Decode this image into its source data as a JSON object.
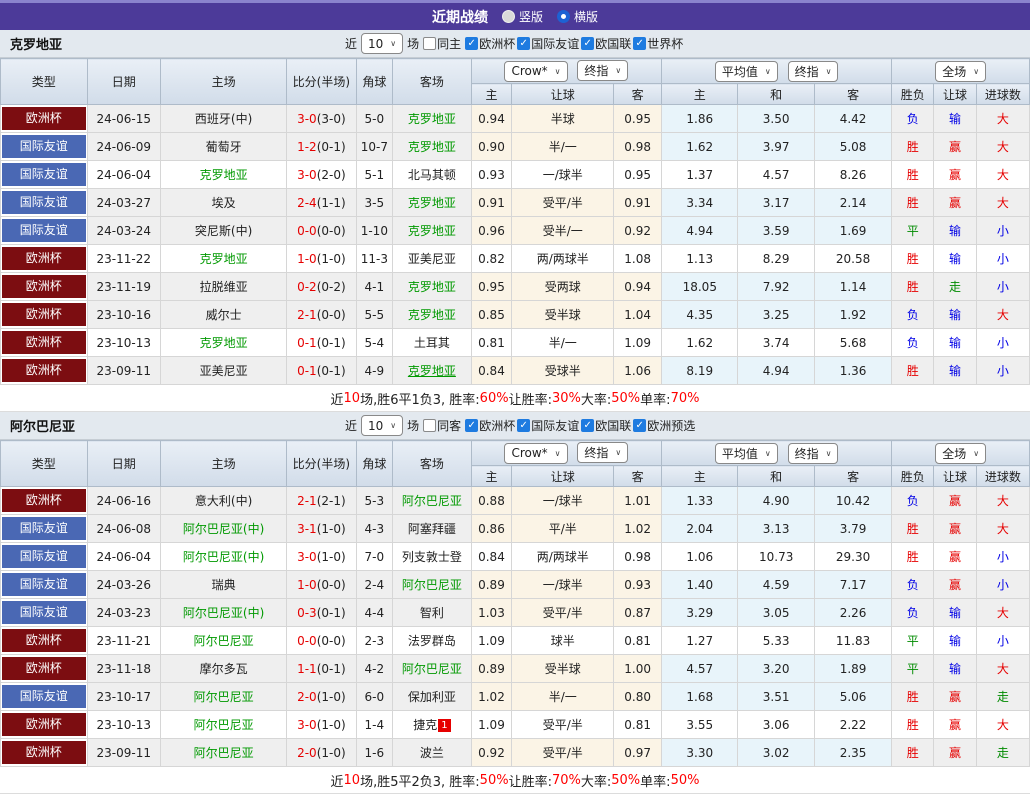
{
  "titlebar": {
    "title": "近期战绩",
    "layout_radios": {
      "vertical": {
        "label": "竖版",
        "selected": true
      },
      "horizontal": {
        "label": "横版",
        "selected": false
      }
    }
  },
  "table_header": {
    "type": "类型",
    "date": "日期",
    "home": "主场",
    "score": "比分(半场)",
    "corner": "角球",
    "away": "客场",
    "book_select": "Crow*",
    "final_select1": "终指",
    "avg_select": "平均值",
    "final_select2": "终指",
    "scope_select": "全场",
    "sub": [
      "主",
      "让球",
      "客",
      "主",
      "和",
      "客",
      "胜负",
      "让球",
      "进球数"
    ]
  },
  "icons": {
    "check": "✓",
    "chevron_down": "∨"
  },
  "colors": {
    "titlebar_bg": "#4c3a99",
    "league_colors": {
      "欧洲杯": "#7c0d11",
      "国际友谊": "#4a68b4"
    },
    "subject_team": "#009900",
    "score_red": "#e60000",
    "crow_col_bg": "#fbf4e6",
    "avg_col_bg": "#e8f4fa",
    "result_text_colors": {
      "胜": "#e60000",
      "赢": "#e60000",
      "大": "#e60000",
      "负": "#0000e6",
      "输": "#0000e6",
      "小": "#0000e6",
      "平": "#008b00",
      "走": "#008b00"
    }
  },
  "sections": [
    {
      "team": "克罗地亚",
      "filter": {
        "near_label": "近",
        "count": "10",
        "unit_label": "场",
        "same_label": "同主",
        "same_checked": false,
        "leagues": [
          {
            "label": "欧洲杯",
            "checked": true
          },
          {
            "label": "国际友谊",
            "checked": true
          },
          {
            "label": "欧国联",
            "checked": true
          },
          {
            "label": "世界杯",
            "checked": true
          }
        ]
      },
      "rows": [
        {
          "league": "欧洲杯",
          "date": "24-06-15",
          "home": "西班牙(中)",
          "home_subject": false,
          "score": "3-0",
          "half": "(3-0)",
          "corner": "5-0",
          "away": "克罗地亚",
          "away_subject": true,
          "odds_home": "0.94",
          "handicap": "半球",
          "odds_away": "0.95",
          "avg_home": "1.86",
          "avg_draw": "3.50",
          "avg_away": "4.42",
          "res_match": "负",
          "res_handicap": "输",
          "res_goals": "大"
        },
        {
          "league": "国际友谊",
          "date": "24-06-09",
          "home": "葡萄牙",
          "home_subject": false,
          "score": "1-2",
          "half": "(0-1)",
          "corner": "10-7",
          "away": "克罗地亚",
          "away_subject": true,
          "odds_home": "0.90",
          "handicap": "半/一",
          "odds_away": "0.98",
          "avg_home": "1.62",
          "avg_draw": "3.97",
          "avg_away": "5.08",
          "res_match": "胜",
          "res_handicap": "赢",
          "res_goals": "大"
        },
        {
          "league": "国际友谊",
          "date": "24-06-04",
          "home": "克罗地亚",
          "home_subject": true,
          "score": "3-0",
          "half": "(2-0)",
          "corner": "5-1",
          "away": "北马其顿",
          "away_subject": false,
          "odds_home": "0.93",
          "handicap": "一/球半",
          "odds_away": "0.95",
          "avg_home": "1.37",
          "avg_draw": "4.57",
          "avg_away": "8.26",
          "res_match": "胜",
          "res_handicap": "赢",
          "res_goals": "大"
        },
        {
          "league": "国际友谊",
          "date": "24-03-27",
          "home": "埃及",
          "home_subject": false,
          "score": "2-4",
          "half": "(1-1)",
          "corner": "3-5",
          "away": "克罗地亚",
          "away_subject": true,
          "odds_home": "0.91",
          "handicap": "受平/半",
          "odds_away": "0.91",
          "avg_home": "3.34",
          "avg_draw": "3.17",
          "avg_away": "2.14",
          "res_match": "胜",
          "res_handicap": "赢",
          "res_goals": "大"
        },
        {
          "league": "国际友谊",
          "date": "24-03-24",
          "home": "突尼斯(中)",
          "home_subject": false,
          "score": "0-0",
          "half": "(0-0)",
          "corner": "1-10",
          "away": "克罗地亚",
          "away_subject": true,
          "odds_home": "0.96",
          "handicap": "受半/一",
          "odds_away": "0.92",
          "avg_home": "4.94",
          "avg_draw": "3.59",
          "avg_away": "1.69",
          "res_match": "平",
          "res_handicap": "输",
          "res_goals": "小"
        },
        {
          "league": "欧洲杯",
          "date": "23-11-22",
          "home": "克罗地亚",
          "home_subject": true,
          "score": "1-0",
          "half": "(1-0)",
          "corner": "11-3",
          "away": "亚美尼亚",
          "away_subject": false,
          "odds_home": "0.82",
          "handicap": "两/两球半",
          "odds_away": "1.08",
          "avg_home": "1.13",
          "avg_draw": "8.29",
          "avg_away": "20.58",
          "res_match": "胜",
          "res_handicap": "输",
          "res_goals": "小"
        },
        {
          "league": "欧洲杯",
          "date": "23-11-19",
          "home": "拉脱维亚",
          "home_subject": false,
          "score": "0-2",
          "half": "(0-2)",
          "corner": "4-1",
          "away": "克罗地亚",
          "away_subject": true,
          "odds_home": "0.95",
          "handicap": "受两球",
          "odds_away": "0.94",
          "avg_home": "18.05",
          "avg_draw": "7.92",
          "avg_away": "1.14",
          "res_match": "胜",
          "res_handicap": "走",
          "res_goals": "小"
        },
        {
          "league": "欧洲杯",
          "date": "23-10-16",
          "home": "威尔士",
          "home_subject": false,
          "score": "2-1",
          "half": "(0-0)",
          "corner": "5-5",
          "away": "克罗地亚",
          "away_subject": true,
          "odds_home": "0.85",
          "handicap": "受半球",
          "odds_away": "1.04",
          "avg_home": "4.35",
          "avg_draw": "3.25",
          "avg_away": "1.92",
          "res_match": "负",
          "res_handicap": "输",
          "res_goals": "大"
        },
        {
          "league": "欧洲杯",
          "date": "23-10-13",
          "home": "克罗地亚",
          "home_subject": true,
          "score": "0-1",
          "half": "(0-1)",
          "corner": "5-4",
          "away": "土耳其",
          "away_subject": false,
          "odds_home": "0.81",
          "handicap": "半/一",
          "odds_away": "1.09",
          "avg_home": "1.62",
          "avg_draw": "3.74",
          "avg_away": "5.68",
          "res_match": "负",
          "res_handicap": "输",
          "res_goals": "小"
        },
        {
          "league": "欧洲杯",
          "date": "23-09-11",
          "home": "亚美尼亚",
          "home_subject": false,
          "score": "0-1",
          "half": "(0-1)",
          "corner": "4-9",
          "away": "克罗地亚",
          "away_subject": true,
          "away_underline": true,
          "odds_home": "0.84",
          "handicap": "受球半",
          "odds_away": "1.06",
          "avg_home": "8.19",
          "avg_draw": "4.94",
          "avg_away": "1.36",
          "res_match": "胜",
          "res_handicap": "输",
          "res_goals": "小"
        }
      ],
      "summary": [
        {
          "text": "近",
          "red": false
        },
        {
          "text": "10",
          "red": true
        },
        {
          "text": "场,胜6平1负3, 胜率:",
          "red": false
        },
        {
          "text": "60%",
          "red": true
        },
        {
          "text": " 让胜率:",
          "red": false
        },
        {
          "text": "30%",
          "red": true
        },
        {
          "text": " 大率:",
          "red": false
        },
        {
          "text": "50%",
          "red": true
        },
        {
          "text": " 单率:",
          "red": false
        },
        {
          "text": "70%",
          "red": true
        }
      ]
    },
    {
      "team": "阿尔巴尼亚",
      "filter": {
        "near_label": "近",
        "count": "10",
        "unit_label": "场",
        "same_label": "同客",
        "same_checked": false,
        "leagues": [
          {
            "label": "欧洲杯",
            "checked": true
          },
          {
            "label": "国际友谊",
            "checked": true
          },
          {
            "label": "欧国联",
            "checked": true
          },
          {
            "label": "欧洲预选",
            "checked": true
          }
        ]
      },
      "rows": [
        {
          "league": "欧洲杯",
          "date": "24-06-16",
          "home": "意大利(中)",
          "home_subject": false,
          "score": "2-1",
          "half": "(2-1)",
          "corner": "5-3",
          "away": "阿尔巴尼亚",
          "away_subject": true,
          "odds_home": "0.88",
          "handicap": "一/球半",
          "odds_away": "1.01",
          "avg_home": "1.33",
          "avg_draw": "4.90",
          "avg_away": "10.42",
          "res_match": "负",
          "res_handicap": "赢",
          "res_goals": "大"
        },
        {
          "league": "国际友谊",
          "date": "24-06-08",
          "home": "阿尔巴尼亚(中)",
          "home_subject": true,
          "score": "3-1",
          "half": "(1-0)",
          "corner": "4-3",
          "away": "阿塞拜疆",
          "away_subject": false,
          "odds_home": "0.86",
          "handicap": "平/半",
          "odds_away": "1.02",
          "avg_home": "2.04",
          "avg_draw": "3.13",
          "avg_away": "3.79",
          "res_match": "胜",
          "res_handicap": "赢",
          "res_goals": "大"
        },
        {
          "league": "国际友谊",
          "date": "24-06-04",
          "home": "阿尔巴尼亚(中)",
          "home_subject": true,
          "score": "3-0",
          "half": "(1-0)",
          "corner": "7-0",
          "away": "列支敦士登",
          "away_subject": false,
          "odds_home": "0.84",
          "handicap": "两/两球半",
          "odds_away": "0.98",
          "avg_home": "1.06",
          "avg_draw": "10.73",
          "avg_away": "29.30",
          "res_match": "胜",
          "res_handicap": "赢",
          "res_goals": "小"
        },
        {
          "league": "国际友谊",
          "date": "24-03-26",
          "home": "瑞典",
          "home_subject": false,
          "score": "1-0",
          "half": "(0-0)",
          "corner": "2-4",
          "away": "阿尔巴尼亚",
          "away_subject": true,
          "odds_home": "0.89",
          "handicap": "一/球半",
          "odds_away": "0.93",
          "avg_home": "1.40",
          "avg_draw": "4.59",
          "avg_away": "7.17",
          "res_match": "负",
          "res_handicap": "赢",
          "res_goals": "小"
        },
        {
          "league": "国际友谊",
          "date": "24-03-23",
          "home": "阿尔巴尼亚(中)",
          "home_subject": true,
          "score": "0-3",
          "half": "(0-1)",
          "corner": "4-4",
          "away": "智利",
          "away_subject": false,
          "odds_home": "1.03",
          "handicap": "受平/半",
          "odds_away": "0.87",
          "avg_home": "3.29",
          "avg_draw": "3.05",
          "avg_away": "2.26",
          "res_match": "负",
          "res_handicap": "输",
          "res_goals": "大"
        },
        {
          "league": "欧洲杯",
          "date": "23-11-21",
          "home": "阿尔巴尼亚",
          "home_subject": true,
          "score": "0-0",
          "half": "(0-0)",
          "corner": "2-3",
          "away": "法罗群岛",
          "away_subject": false,
          "odds_home": "1.09",
          "handicap": "球半",
          "odds_away": "0.81",
          "avg_home": "1.27",
          "avg_draw": "5.33",
          "avg_away": "11.83",
          "res_match": "平",
          "res_handicap": "输",
          "res_goals": "小"
        },
        {
          "league": "欧洲杯",
          "date": "23-11-18",
          "home": "摩尔多瓦",
          "home_subject": false,
          "score": "1-1",
          "half": "(0-1)",
          "corner": "4-2",
          "away": "阿尔巴尼亚",
          "away_subject": true,
          "odds_home": "0.89",
          "handicap": "受半球",
          "odds_away": "1.00",
          "avg_home": "4.57",
          "avg_draw": "3.20",
          "avg_away": "1.89",
          "res_match": "平",
          "res_handicap": "输",
          "res_goals": "大"
        },
        {
          "league": "国际友谊",
          "date": "23-10-17",
          "home": "阿尔巴尼亚",
          "home_subject": true,
          "score": "2-0",
          "half": "(1-0)",
          "corner": "6-0",
          "away": "保加利亚",
          "away_subject": false,
          "odds_home": "1.02",
          "handicap": "半/一",
          "odds_away": "0.80",
          "avg_home": "1.68",
          "avg_draw": "3.51",
          "avg_away": "5.06",
          "res_match": "胜",
          "res_handicap": "赢",
          "res_goals": "走"
        },
        {
          "league": "欧洲杯",
          "date": "23-10-13",
          "home": "阿尔巴尼亚",
          "home_subject": true,
          "score": "3-0",
          "half": "(1-0)",
          "corner": "1-4",
          "away": "捷克",
          "away_subject": false,
          "away_card": "1",
          "odds_home": "1.09",
          "handicap": "受平/半",
          "odds_away": "0.81",
          "avg_home": "3.55",
          "avg_draw": "3.06",
          "avg_away": "2.22",
          "res_match": "胜",
          "res_handicap": "赢",
          "res_goals": "大"
        },
        {
          "league": "欧洲杯",
          "date": "23-09-11",
          "home": "阿尔巴尼亚",
          "home_subject": true,
          "score": "2-0",
          "half": "(1-0)",
          "corner": "1-6",
          "away": "波兰",
          "away_subject": false,
          "odds_home": "0.92",
          "handicap": "受平/半",
          "odds_away": "0.97",
          "avg_home": "3.30",
          "avg_draw": "3.02",
          "avg_away": "2.35",
          "res_match": "胜",
          "res_handicap": "赢",
          "res_goals": "走"
        }
      ],
      "summary": [
        {
          "text": "近",
          "red": false
        },
        {
          "text": "10",
          "red": true
        },
        {
          "text": "场,胜5平2负3, 胜率:",
          "red": false
        },
        {
          "text": "50%",
          "red": true
        },
        {
          "text": " 让胜率:",
          "red": false
        },
        {
          "text": "70%",
          "red": true
        },
        {
          "text": " 大率:",
          "red": false
        },
        {
          "text": "50%",
          "red": true
        },
        {
          "text": " 单率:",
          "red": false
        },
        {
          "text": "50%",
          "red": true
        }
      ]
    }
  ]
}
